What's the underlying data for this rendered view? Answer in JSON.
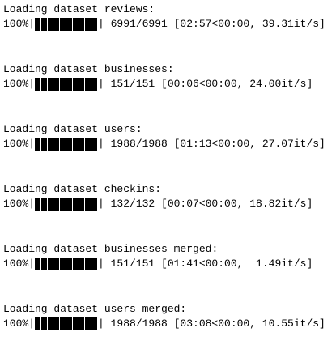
{
  "outputs": [
    {
      "label": "Loading dataset reviews:",
      "percent": "100%",
      "progress": 1.0,
      "stats": "6991/6991 [02:57<00:00, 39.31it/s]"
    },
    {
      "label": "Loading dataset businesses:",
      "percent": "100%",
      "progress": 1.0,
      "stats": "151/151 [00:06<00:00, 24.00it/s]"
    },
    {
      "label": "Loading dataset users:",
      "percent": "100%",
      "progress": 1.0,
      "stats": "1988/1988 [01:13<00:00, 27.07it/s]"
    },
    {
      "label": "Loading dataset checkins:",
      "percent": "100%",
      "progress": 1.0,
      "stats": "132/132 [00:07<00:00, 18.82it/s]"
    },
    {
      "label": "Loading dataset businesses_merged:",
      "percent": "100%",
      "progress": 1.0,
      "stats": "151/151 [01:41<00:00,  1.49it/s]"
    },
    {
      "label": "Loading dataset users_merged:",
      "percent": "100%",
      "progress": 1.0,
      "stats": "1988/1988 [03:08<00:00, 10.55it/s]"
    }
  ],
  "colors": {
    "text": "#000000",
    "bar": "#000000",
    "background": "#ffffff"
  }
}
